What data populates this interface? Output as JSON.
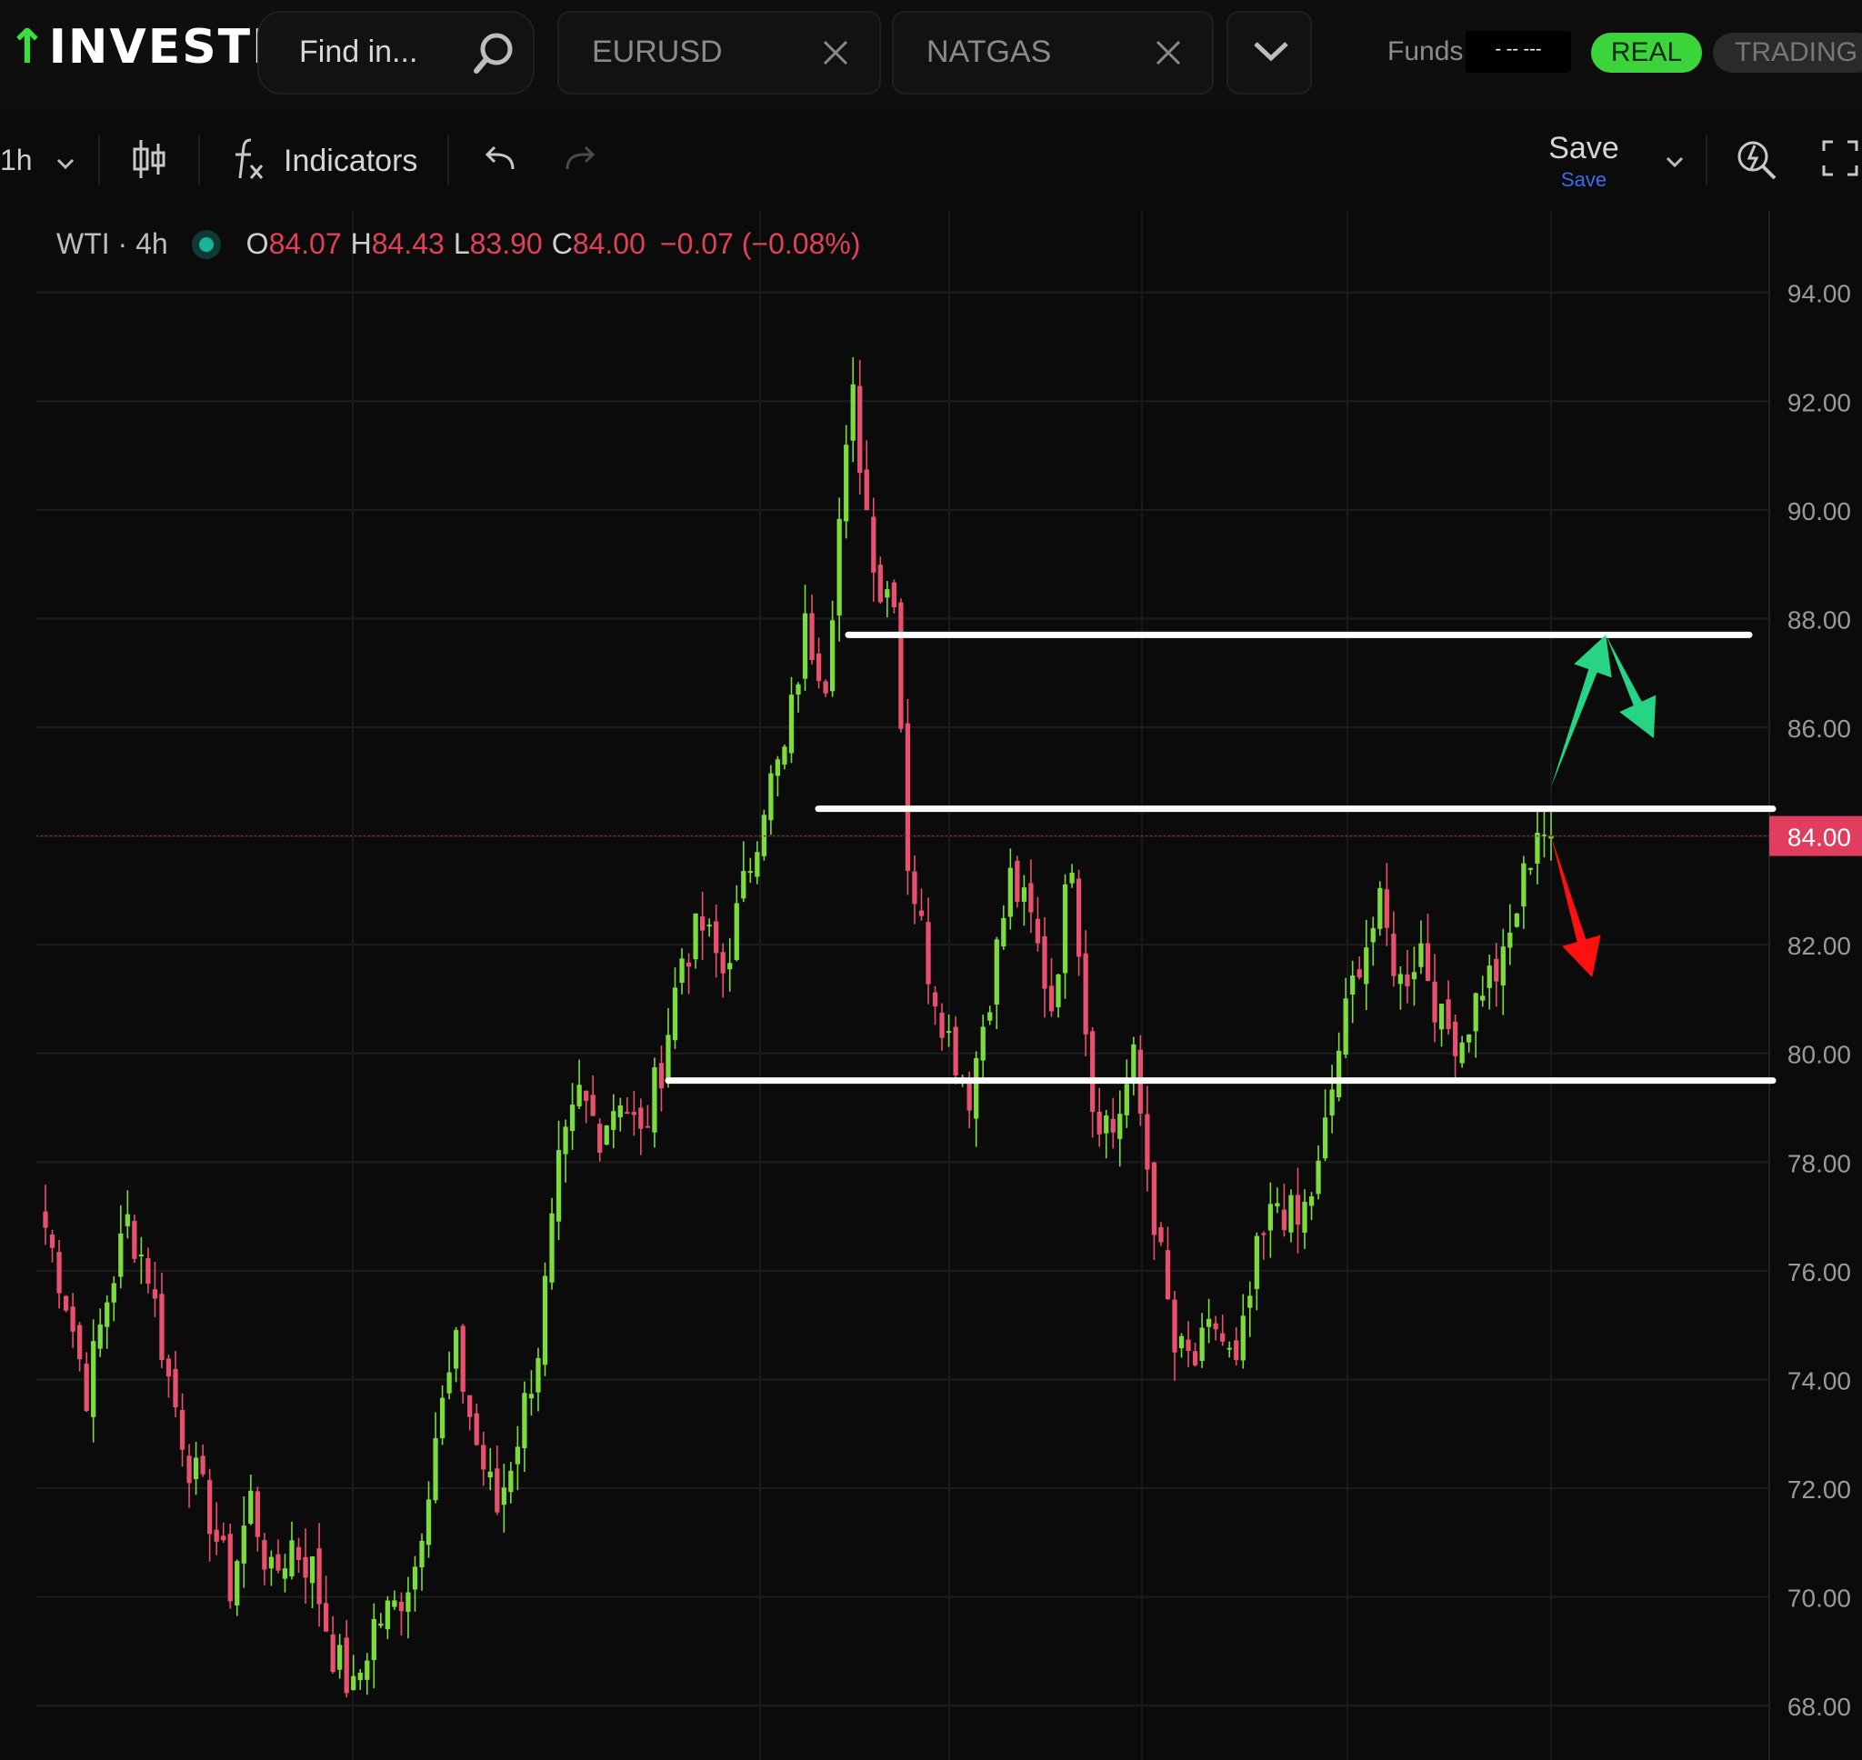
{
  "app": {
    "logo_text": "INVESTIZO",
    "search_placeholder": "Find in...",
    "tabs": [
      {
        "label": "EURUSD"
      },
      {
        "label": "NATGAS"
      }
    ],
    "funds_label": "Funds:",
    "funds_value": "- -- ---",
    "mode_real": "REAL",
    "mode_trading": "TRADING",
    "colors": {
      "brand_green": "#35e13a",
      "brand_red": "#ff3b3b",
      "real_badge": "#3bd43a"
    }
  },
  "toolbar": {
    "interval": "1h",
    "indicators_label": "Indicators",
    "save_label": "Save",
    "save_sub": "Save"
  },
  "legend": {
    "symbol": "WTI · 4h",
    "o_label": "O",
    "o_value": "84.07",
    "h_label": "H",
    "h_value": "84.43",
    "l_label": "L",
    "l_value": "83.90",
    "c_label": "C",
    "c_value": "84.00",
    "change": "−0.07 (−0.08%)"
  },
  "chart_data": {
    "type": "candlestick",
    "symbol": "WTI",
    "timeframe": "4h",
    "ylim": [
      67,
      95.5
    ],
    "y_ticks": [
      "94.00",
      "92.00",
      "90.00",
      "88.00",
      "86.00",
      "84.00",
      "82.00",
      "80.00",
      "78.00",
      "76.00",
      "74.00",
      "72.00",
      "70.00",
      "68.00"
    ],
    "current_price": "84.00",
    "colors": {
      "up": "#7bdc3c",
      "down": "#e8506e",
      "price_tag": "#e03d5f",
      "bull_arrow": "#27d484",
      "bear_arrow": "#ff1010",
      "level_line": "#ffffff"
    },
    "close_path": [
      [
        0,
        76.8
      ],
      [
        3,
        75.5
      ],
      [
        6,
        73.8
      ],
      [
        9,
        75.5
      ],
      [
        12,
        76.9
      ],
      [
        15,
        76.0
      ],
      [
        18,
        74.0
      ],
      [
        21,
        72.5
      ],
      [
        24,
        71.5
      ],
      [
        27,
        70.2
      ],
      [
        30,
        71.8
      ],
      [
        33,
        70.3
      ],
      [
        36,
        71.0
      ],
      [
        39,
        70.5
      ],
      [
        42,
        69.0
      ],
      [
        45,
        68.2
      ],
      [
        48,
        69.5
      ],
      [
        51,
        69.8
      ],
      [
        54,
        70.6
      ],
      [
        57,
        73.0
      ],
      [
        60,
        74.5
      ],
      [
        63,
        72.8
      ],
      [
        66,
        71.6
      ],
      [
        69,
        73.0
      ],
      [
        72,
        74.6
      ],
      [
        75,
        77.8
      ],
      [
        78,
        79.2
      ],
      [
        81,
        78.6
      ],
      [
        84,
        79.3
      ],
      [
        87,
        78.4
      ],
      [
        90,
        79.8
      ],
      [
        93,
        81.8
      ],
      [
        96,
        82.3
      ],
      [
        99,
        81.5
      ],
      [
        102,
        83.0
      ],
      [
        105,
        84.7
      ],
      [
        108,
        85.5
      ],
      [
        111,
        87.8
      ],
      [
        114,
        87.0
      ],
      [
        116,
        89.8
      ],
      [
        118,
        92.0
      ],
      [
        120,
        90.0
      ],
      [
        122,
        88.5
      ],
      [
        124,
        88.6
      ],
      [
        126,
        83.6
      ],
      [
        129,
        81.6
      ],
      [
        132,
        80.3
      ],
      [
        135,
        79.3
      ],
      [
        138,
        81.2
      ],
      [
        141,
        83.2
      ],
      [
        144,
        82.4
      ],
      [
        147,
        80.9
      ],
      [
        150,
        83.7
      ],
      [
        153,
        79.1
      ],
      [
        156,
        78.6
      ],
      [
        159,
        79.8
      ],
      [
        162,
        77.0
      ],
      [
        165,
        74.5
      ],
      [
        168,
        74.3
      ],
      [
        171,
        75.0
      ],
      [
        174,
        74.1
      ],
      [
        177,
        76.2
      ],
      [
        180,
        77.3
      ],
      [
        183,
        76.8
      ],
      [
        186,
        77.8
      ],
      [
        189,
        80.1
      ],
      [
        192,
        81.8
      ],
      [
        195,
        82.6
      ],
      [
        198,
        81.3
      ],
      [
        201,
        82.0
      ],
      [
        204,
        80.5
      ],
      [
        207,
        80.3
      ],
      [
        210,
        81.3
      ],
      [
        213,
        81.6
      ],
      [
        216,
        83.2
      ],
      [
        218,
        84.2
      ],
      [
        220,
        84.0
      ]
    ],
    "levels": [
      {
        "value": 87.7
      },
      {
        "value": 84.5
      },
      {
        "value": 79.5
      }
    ],
    "annotations": [
      {
        "type": "arrow",
        "color": "bull_arrow",
        "from": [
          220,
          84.9
        ],
        "to": [
          228,
          87.7
        ]
      },
      {
        "type": "arrow",
        "color": "bull_arrow",
        "from": [
          228,
          87.7
        ],
        "to": [
          235,
          85.8
        ]
      },
      {
        "type": "arrow",
        "color": "bear_arrow",
        "from": [
          220,
          84.0
        ],
        "to": [
          226,
          81.4
        ]
      }
    ]
  }
}
